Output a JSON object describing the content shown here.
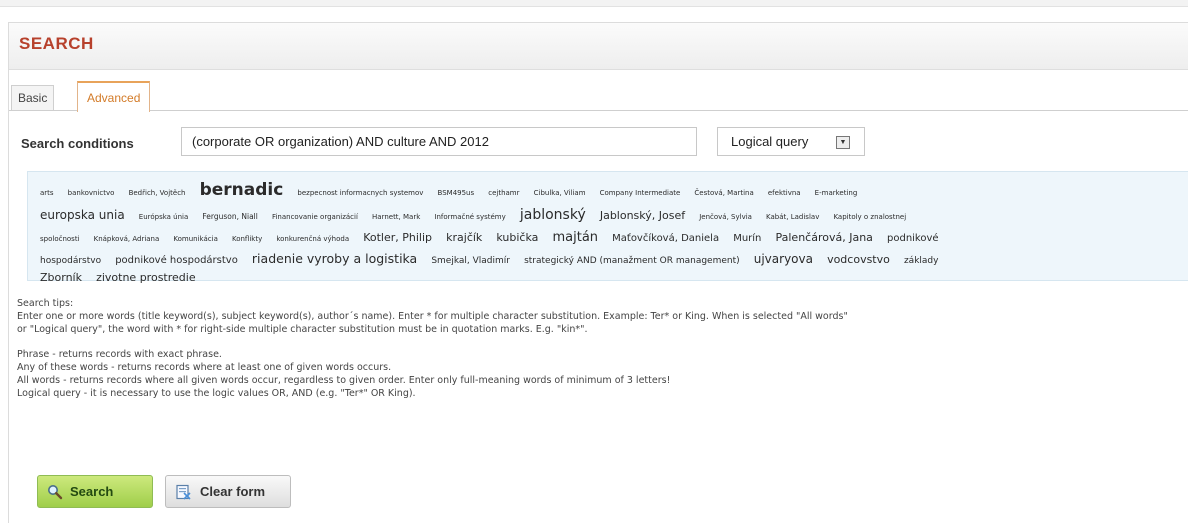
{
  "panel": {
    "title": "SEARCH"
  },
  "tabs": [
    {
      "label": "Basic"
    },
    {
      "label": "Advanced"
    }
  ],
  "search": {
    "label": "Search conditions",
    "value": "(corporate OR organization) AND culture AND 2012",
    "query_type": "Logical query"
  },
  "tag_cloud": {
    "rows": [
      [
        "arts",
        "bankovnictvo",
        "Bedřich, Vojtěch",
        "bernadic",
        "bezpecnost informacnych systemov",
        "BSM495us",
        "cejthamr",
        "Cibulka, Viliam",
        "Company Intermediate",
        "Čestová, Martina",
        "efektivna",
        "E-marketing"
      ],
      [
        "europska unia",
        "Európska únia",
        "Ferguson, Niall",
        "Financovanie organizácií",
        "Harnett, Mark",
        "Informačné systémy",
        "jablonský",
        "Jablonský, Josef",
        "Jenčová, Sylvia",
        "Kabát, Ladislav",
        "Kapitoly o znalostnej"
      ],
      [
        "spoločnosti",
        "Knápková, Adriana",
        "Komunikácia",
        "Konflikty",
        "konkurenčná výhoda",
        "Kotler, Philip",
        "krajčík",
        "kubička",
        "majtán",
        "Maťovčíková, Daniela",
        "Murín",
        "Palenčárová, Jana",
        "podnikové"
      ],
      [
        "hospodárstvo",
        "podnikové hospodárstvo",
        "riadenie vyroby a logistika",
        "Smejkal, Vladimír",
        "strategický AND (manažment OR management)",
        "ujvaryova",
        "vodcovstvo",
        "základy"
      ],
      [
        "Zborník",
        "zivotne prostredie"
      ]
    ]
  },
  "tips": {
    "heading": "Search tips:",
    "line1": "Enter one or more words (title keyword(s), subject keyword(s), author´s name). Enter * for multiple character substitution. Example: Ter* or King. When is selected \"All words\"",
    "line2": "or \"Logical query\", the word with * for right-side multiple character substitution must be in quotation marks. E.g. \"kin*\".",
    "phrase": "Phrase - returns records with exact phrase.",
    "any": "Any of these words - returns records where at least one of given words occurs.",
    "all": "All words - returns records where all given words occur, regardless to given order. Enter only full-meaning words of minimum of 3 letters!",
    "logical": "Logical query - it is necessary to use the logic values OR, AND (e.g. \"Ter*\" OR King)."
  },
  "buttons": {
    "search": "Search",
    "clear": "Clear form"
  }
}
